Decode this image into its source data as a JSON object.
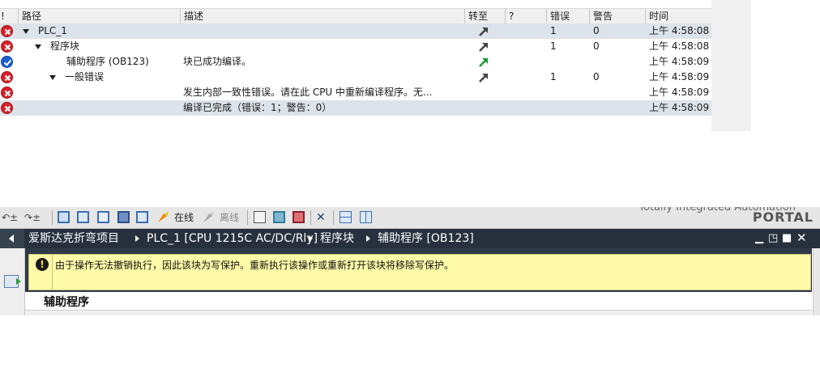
{
  "diagnostics": {
    "columns": [
      "!",
      "路径",
      "描述",
      "转至",
      "?",
      "错误",
      "警告",
      "时间"
    ],
    "rows": [
      {
        "status": "error",
        "path": "PLC_1",
        "expand": true,
        "desc": "",
        "goto": "dark",
        "errors": "1",
        "warnings": "0",
        "time": "上午 4:58:08",
        "selected": true
      },
      {
        "status": "error",
        "path": "程序块",
        "expand": true,
        "desc": "",
        "goto": "dark",
        "errors": "1",
        "warnings": "0",
        "time": "上午 4:58:08",
        "selected": false
      },
      {
        "status": "ok",
        "path": "辅助程序 (OB123)",
        "expand": false,
        "desc": "块已成功编译。",
        "goto": "green",
        "errors": "",
        "warnings": "",
        "time": "上午 4:58:09",
        "selected": false
      },
      {
        "status": "error",
        "path": "一般错误",
        "expand": true,
        "desc": "",
        "goto": "dark",
        "errors": "1",
        "warnings": "0",
        "time": "上午 4:58:09",
        "selected": false
      },
      {
        "status": "error",
        "path": "",
        "expand": false,
        "desc": "发生内部一致性错误。请在此 CPU 中重新编译程序。无...",
        "goto": "",
        "errors": "",
        "warnings": "",
        "time": "上午 4:58:09",
        "selected": false
      },
      {
        "status": "error",
        "path": "",
        "expand": false,
        "desc": "编译已完成（错误：1；警告：0）",
        "goto": "",
        "errors": "",
        "warnings": "",
        "time": "上午 4:58:09",
        "selected": true
      }
    ]
  },
  "toolbar": {
    "online_label": "在线",
    "offline_label": "离线",
    "tia_label": "Totally Integrated Automation",
    "portal_label": "PORTAL"
  },
  "editor": {
    "breadcrumb": [
      "爱斯达克折弯项目",
      "PLC_1 [CPU 1215C AC/DC/Rly]",
      "程序块",
      "辅助程序 [OB123]"
    ],
    "warning_text": "由于操作无法撤销执行，因此该块为写保护。重新执行该操作或重新打开该块将移除写保护。",
    "block_title": "辅助程序"
  },
  "colors": {
    "error": "#d8202a",
    "ok": "#1f5fd0",
    "titlebar": "#27313d",
    "warning_bg": "#fffba8"
  }
}
